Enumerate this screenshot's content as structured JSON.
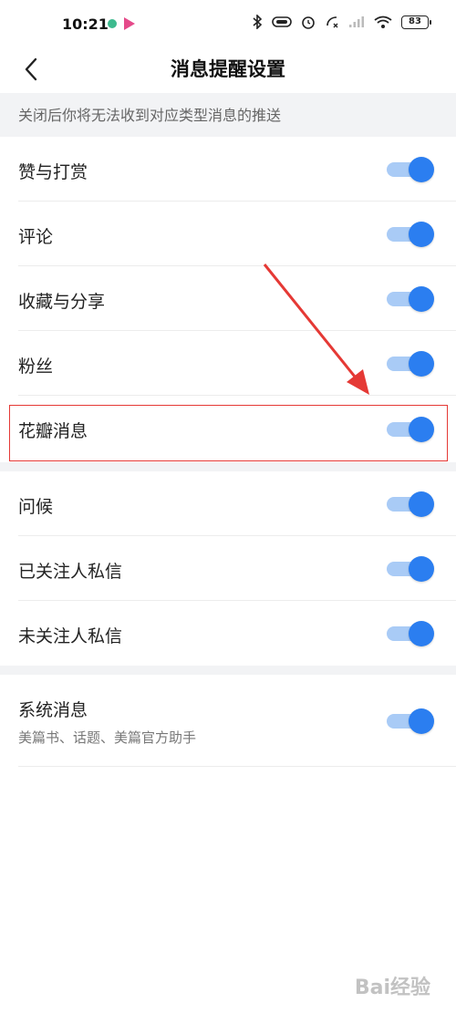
{
  "status_bar": {
    "time": "10:21",
    "battery": "83",
    "icons": [
      "app-dot-icon",
      "play-store-icon",
      "bluetooth-icon",
      "vibrate-icon",
      "alarm-icon",
      "missed-call-icon",
      "signal-icon",
      "wifi-icon",
      "battery-icon"
    ]
  },
  "header": {
    "title": "消息提醒设置",
    "back_icon": "back-arrow-icon"
  },
  "notice": "关闭后你将无法收到对应类型消息的推送",
  "settings": {
    "group1": [
      {
        "label": "赞与打赏",
        "enabled": true
      },
      {
        "label": "评论",
        "enabled": true
      },
      {
        "label": "收藏与分享",
        "enabled": true
      },
      {
        "label": "粉丝",
        "enabled": true
      },
      {
        "label": "花瓣消息",
        "enabled": true
      }
    ],
    "group2": [
      {
        "label": "问候",
        "enabled": true
      },
      {
        "label": "已关注人私信",
        "enabled": true
      },
      {
        "label": "未关注人私信",
        "enabled": true
      }
    ],
    "group3": [
      {
        "label": "系统消息",
        "sublabel": "美篇书、话题、美篇官方助手",
        "enabled": true
      }
    ]
  },
  "annotation": {
    "highlight_color": "#e53935",
    "highlighted_item": "花瓣消息"
  },
  "colors": {
    "toggle_on": "#2b7ef0",
    "toggle_track": "#a9cbf6",
    "section_bg": "#f2f3f5"
  },
  "watermark": "Bai经验"
}
